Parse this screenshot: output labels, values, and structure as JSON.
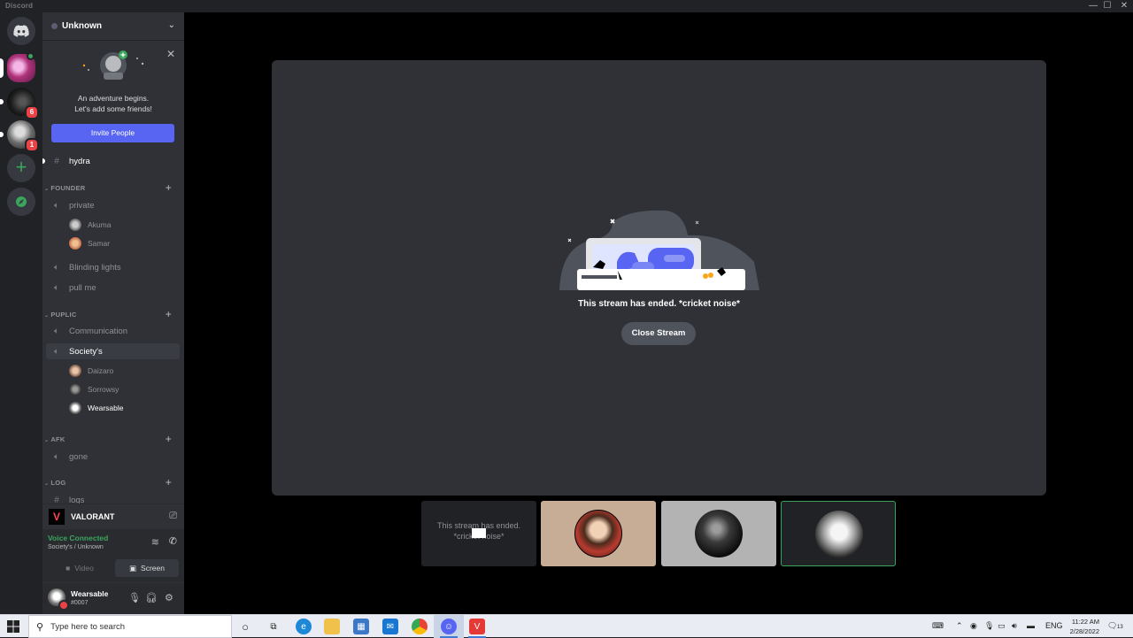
{
  "window": {
    "title": "Discord",
    "min": "—",
    "max": "☐",
    "close": "✕"
  },
  "rail": {
    "servers": [
      {
        "name": "server-1",
        "badge": ""
      },
      {
        "name": "server-2",
        "badge": "6"
      },
      {
        "name": "server-3",
        "badge": "1"
      }
    ],
    "add_symbol": "+"
  },
  "server": {
    "name": "Unknown",
    "chevron": "⌄"
  },
  "invite_card": {
    "line1": "An adventure begins.",
    "line2": "Let's add some friends!",
    "button": "Invite People",
    "close": "✕"
  },
  "channels": {
    "hydra": "hydra",
    "cat_founder": "FOUNDER",
    "private": "private",
    "private_users": [
      "Akuma",
      "Samar"
    ],
    "blinding": "Blinding lights",
    "pullme": "pull me",
    "cat_puplic": "PUPLIC",
    "communication": "Communication",
    "societys": "Society's",
    "societys_users": [
      "Daizaro",
      "Sorrowsy",
      "Wearsable"
    ],
    "cat_afk": "AFK",
    "gone": "gone",
    "cat_log": "LOG",
    "logs": "logs",
    "plus": "+"
  },
  "activity": {
    "game": "VALORANT"
  },
  "voice": {
    "status": "Voice Connected",
    "location": "Society's / Unknown",
    "video": "Video",
    "screen": "Screen"
  },
  "user": {
    "name": "Wearsable",
    "tag": "#0007"
  },
  "stream": {
    "message": "This stream has ended. *cricket noise*",
    "close_button": "Close Stream"
  },
  "tiles": {
    "ended_text_1": "This stream has ended.",
    "ended_text_2": "*cricket noise*"
  },
  "taskbar": {
    "search_placeholder": "Type here to search",
    "lang": "ENG",
    "time": "11:22 AM",
    "date": "2/28/2022",
    "notif_count": "13"
  },
  "colors": {
    "accent": "#5865f2",
    "online": "#3ba55d",
    "danger": "#ed4245"
  }
}
